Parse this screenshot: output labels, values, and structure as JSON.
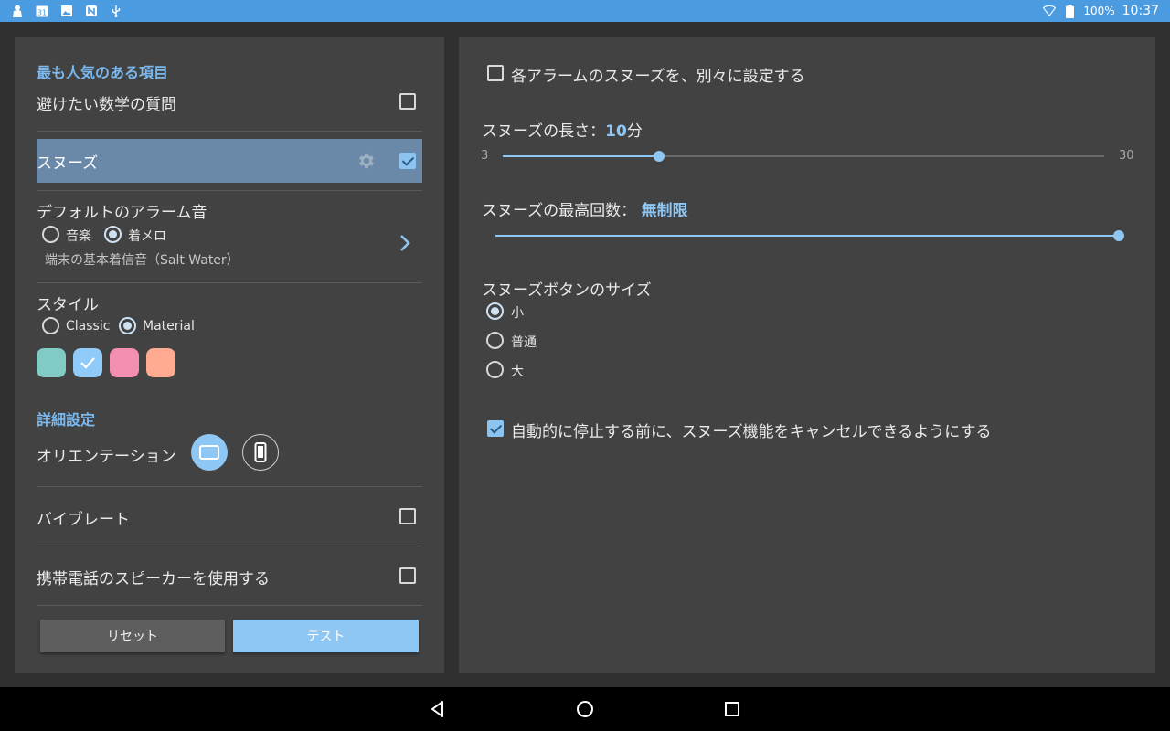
{
  "status_bar": {
    "left_icons": [
      "person-icon",
      "calendar-icon",
      "image-icon",
      "nfc-icon",
      "usb-icon"
    ],
    "calendar_day": "31",
    "battery_percent": "100%",
    "time": "10:37",
    "color": "#4a9be0"
  },
  "left": {
    "popular_header": "最も人気のある項目",
    "math_question_label": "避けたい数学の質問",
    "math_question_checked": false,
    "snooze_label": "スヌーズ",
    "snooze_checked": true,
    "alarm_sound": {
      "title": "デフォルトのアラーム音",
      "options": [
        "音楽",
        "着メロ"
      ],
      "selected": "着メロ",
      "current": "端末の基本着信音（Salt Water）"
    },
    "style": {
      "title": "スタイル",
      "options": [
        "Classic",
        "Material"
      ],
      "selected": "Material",
      "swatches": [
        "#80cbc4",
        "#90caf9",
        "#f48fb1",
        "#ffab91"
      ],
      "selected_swatch": 1
    },
    "advanced_header": "詳細設定",
    "orientation_label": "オリエンテーション",
    "orientation_selected": "landscape",
    "vibrate_label": "バイブレート",
    "vibrate_checked": false,
    "speaker_label": "携帯電話のスピーカーを使用する",
    "speaker_checked": false,
    "reset_button": "リセット",
    "test_button": "テスト"
  },
  "right": {
    "individual_snooze_label": "各アラームのスヌーズを、別々に設定する",
    "individual_snooze_checked": false,
    "snooze_length_label": "スヌーズの長さ：",
    "snooze_length_value": "10",
    "snooze_length_unit": "分",
    "snooze_length_min": "3",
    "snooze_length_max": "30",
    "snooze_length_fraction": 0.26,
    "snooze_max_label": "スヌーズの最高回数：",
    "snooze_max_value": "無制限",
    "snooze_max_fraction": 1.0,
    "button_size": {
      "title": "スヌーズボタンのサイズ",
      "options": [
        "小",
        "普通",
        "大"
      ],
      "selected": "小"
    },
    "auto_cancel_label": "自動的に停止する前に、スヌーズ機能をキャンセルできるようにする",
    "auto_cancel_checked": true
  },
  "accent_color": "#8ec6f4",
  "nav_icons": [
    "back-icon",
    "home-icon",
    "recents-icon"
  ]
}
